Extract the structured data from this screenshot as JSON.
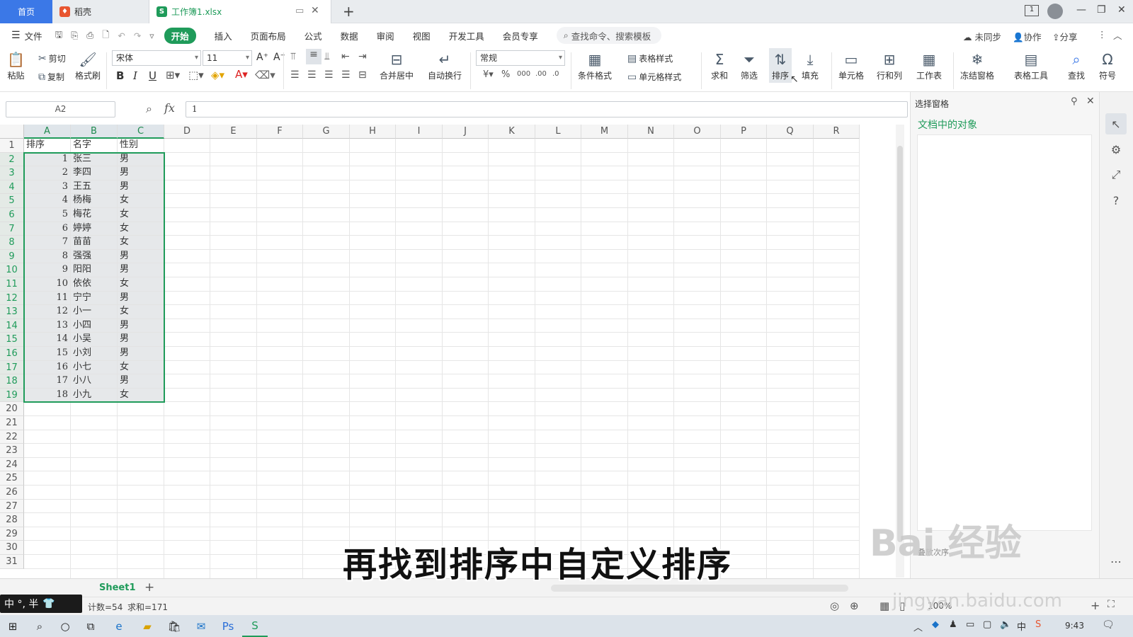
{
  "titlebar": {
    "home_tab": "首页",
    "docer_tab": "稻壳",
    "doc_tab": "工作簿1.xlsx",
    "new_tab": "+",
    "window_btn_min": "—",
    "window_btn_restore": "❐",
    "window_btn_close": "✕"
  },
  "menu": {
    "file": "文件",
    "items": [
      "开始",
      "插入",
      "页面布局",
      "公式",
      "数据",
      "审阅",
      "视图",
      "开发工具",
      "会员专享"
    ],
    "search_placeholder": "查找命令、搜索模板",
    "unsynced": "未同步",
    "collab": "协作",
    "share": "分享"
  },
  "ribbon": {
    "paste": "粘贴",
    "cut": "剪切",
    "copy": "复制",
    "format_painter": "格式刷",
    "font_name": "宋体",
    "font_size": "11",
    "merge_center": "合并居中",
    "auto_wrap": "自动换行",
    "number_format": "常规",
    "cond_format": "条件格式",
    "table_style": "表格样式",
    "cell_style": "单元格样式",
    "sum": "求和",
    "filter": "筛选",
    "sort": "排序",
    "fill": "填充",
    "cells": "单元格",
    "row_col": "行和列",
    "worksheet": "工作表",
    "freeze": "冻结窗格",
    "table_tools": "表格工具",
    "find": "查找",
    "symbol": "符号"
  },
  "formula_bar": {
    "name_box": "A2",
    "fx": "fx",
    "value": "1"
  },
  "columns": [
    "A",
    "B",
    "C",
    "D",
    "E",
    "F",
    "G",
    "H",
    "I",
    "J",
    "K",
    "L",
    "M",
    "N",
    "O",
    "P",
    "Q",
    "R"
  ],
  "header_row": [
    "排序",
    "名字",
    "性别"
  ],
  "rows": [
    [
      "1",
      "张三",
      "男"
    ],
    [
      "2",
      "李四",
      "男"
    ],
    [
      "3",
      "王五",
      "男"
    ],
    [
      "4",
      "杨梅",
      "女"
    ],
    [
      "5",
      "梅花",
      "女"
    ],
    [
      "6",
      "婷婷",
      "女"
    ],
    [
      "7",
      "苗苗",
      "女"
    ],
    [
      "8",
      "强强",
      "男"
    ],
    [
      "9",
      "阳阳",
      "男"
    ],
    [
      "10",
      "依依",
      "女"
    ],
    [
      "11",
      "宁宁",
      "男"
    ],
    [
      "12",
      "小一",
      "女"
    ],
    [
      "13",
      "小四",
      "男"
    ],
    [
      "14",
      "小吴",
      "男"
    ],
    [
      "15",
      "小刘",
      "男"
    ],
    [
      "16",
      "小七",
      "女"
    ],
    [
      "17",
      "小八",
      "男"
    ],
    [
      "18",
      "小九",
      "女"
    ]
  ],
  "row_numbers": [
    "1",
    "2",
    "3",
    "4",
    "5",
    "6",
    "7",
    "8",
    "9",
    "10",
    "11",
    "12",
    "13",
    "14",
    "15",
    "16",
    "17",
    "18",
    "19",
    "20",
    "21",
    "22",
    "23",
    "24",
    "25",
    "26",
    "27",
    "28",
    "29",
    "30",
    "31"
  ],
  "side_panel": {
    "title": "选择窗格",
    "objects_label": "文档中的对象",
    "order_label": "叠放次序"
  },
  "sheetbar": {
    "sheet_name": "Sheet1",
    "add": "+"
  },
  "statusbar": {
    "count": "计数=54",
    "sum": "求和=171",
    "zoom": "100%"
  },
  "ime": {
    "text": "中 °, 半"
  },
  "taskbar": {
    "time": "9:43"
  },
  "caption": "再找到排序中自定义排序",
  "watermark": {
    "brand": "Bai 经验",
    "url": "jingyan.baidu.com"
  },
  "colors": {
    "accent_green": "#1f9b5a",
    "home_tab_blue": "#3b78e7"
  }
}
